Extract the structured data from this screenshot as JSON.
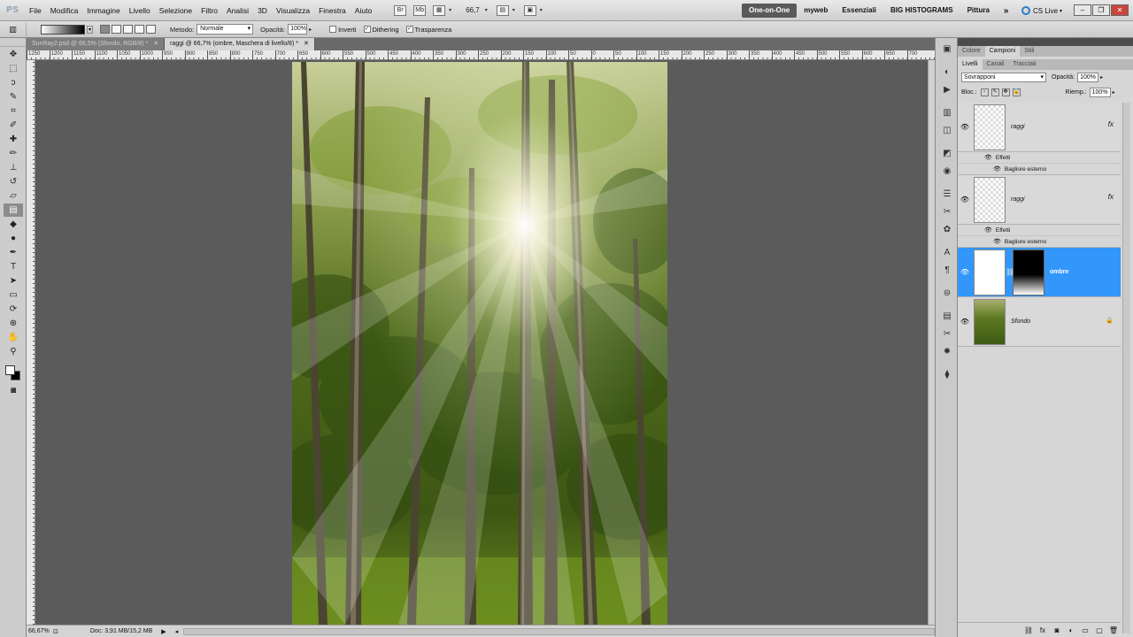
{
  "app": {
    "logo": "PS"
  },
  "menu": [
    "File",
    "Modifica",
    "Immagine",
    "Livello",
    "Selezione",
    "Filtro",
    "Analisi",
    "3D",
    "Visualizza",
    "Finestra",
    "Aiuto"
  ],
  "menubar_tools": {
    "zoom": "66,7"
  },
  "workspaces": [
    "One-on-One",
    "myweb",
    "Essenziali",
    "BIG HISTOGRAMS",
    "Pittura"
  ],
  "workspaces_more": "»",
  "cs_live": "CS Live",
  "options": {
    "method_label": "Metodo:",
    "method_value": "Normale",
    "opacity_label": "Opacità:",
    "opacity_value": "100%",
    "invert_label": "Inverti",
    "dither_label": "Dithering",
    "transparency_label": "Trasparenza"
  },
  "tabs": [
    {
      "label": "SunRay2.psd @ 66,5% (Sfondo, RGB/8) *",
      "active": false
    },
    {
      "label": "raggi @ 66,7% (ombre, Maschera di livello/8) *",
      "active": true
    }
  ],
  "ruler_labels": [
    "1250",
    "1200",
    "1150",
    "1100",
    "1050",
    "1000",
    "950",
    "900",
    "850",
    "800",
    "750",
    "700",
    "650",
    "600",
    "550",
    "500",
    "450",
    "400",
    "350",
    "300",
    "250",
    "200",
    "150",
    "100",
    "50",
    "0",
    "50",
    "100",
    "150",
    "200",
    "250",
    "300",
    "350",
    "400",
    "450",
    "500",
    "550",
    "600",
    "650",
    "700"
  ],
  "status": {
    "zoom": "66,67%",
    "doc": "Doc: 3,91 MB/15,2 MB"
  },
  "panels": {
    "top_tabs": [
      "Colore",
      "Campioni",
      "Stili"
    ],
    "layer_tabs": [
      "Livelli",
      "Canali",
      "Tracciati"
    ],
    "blend_mode": "Sovrapponi",
    "opacity_label": "Opacità:",
    "opacity_value": "100%",
    "lock_label": "Bloc.:",
    "fill_label": "Riemp.:",
    "fill_value": "100%",
    "layers": [
      {
        "name": "raggi",
        "fx": "fx",
        "effects_label": "Effetti",
        "effect": "Bagliore esterno"
      },
      {
        "name": "raggi",
        "fx": "fx",
        "effects_label": "Effetti",
        "effect": "Bagliore esterno"
      },
      {
        "name": "ombre",
        "selected": true
      },
      {
        "name": "Sfondo",
        "locked": true
      }
    ]
  },
  "colors": {
    "selection": "#3296fa",
    "canvas_bg": "#5b5b5b"
  }
}
